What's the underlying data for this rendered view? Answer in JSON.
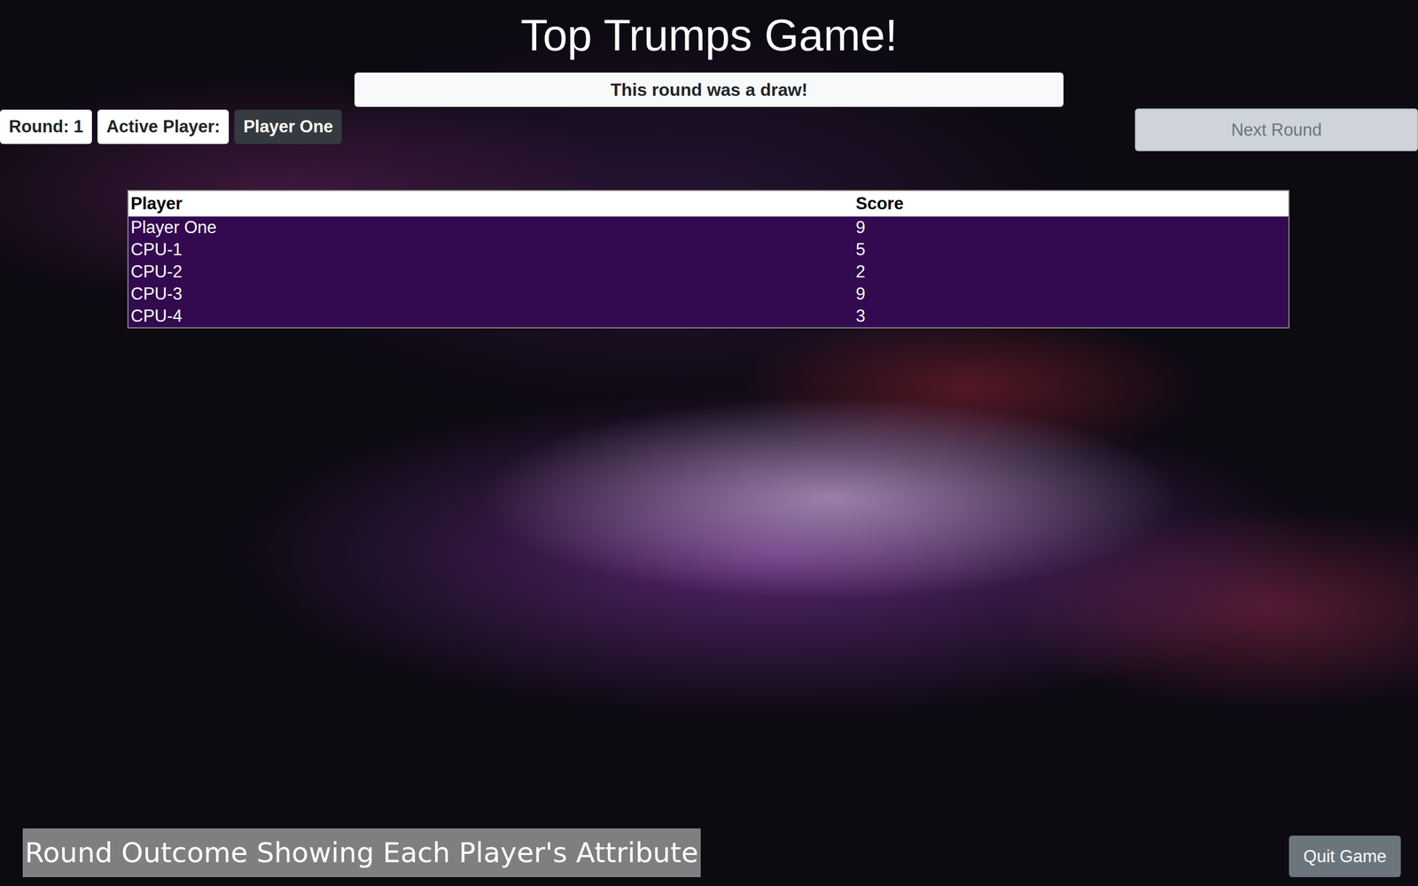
{
  "title": "Top Trumps Game!",
  "message": "This round was a draw!",
  "status": {
    "round": "Round: 1",
    "active_label": "Active Player:",
    "active_player": "Player One"
  },
  "next_button": {
    "label": "Next Round",
    "disabled": true
  },
  "table": {
    "columns": [
      "Player",
      "Score"
    ],
    "rows": [
      [
        "Player One",
        "9"
      ],
      [
        "CPU-1",
        "5"
      ],
      [
        "CPU-2",
        "2"
      ],
      [
        "CPU-3",
        "9"
      ],
      [
        "CPU-4",
        "3"
      ]
    ]
  },
  "caption": "Round Outcome Showing Each Player's Attribute",
  "quit_button": {
    "label": "Quit Game",
    "disabled": false
  }
}
